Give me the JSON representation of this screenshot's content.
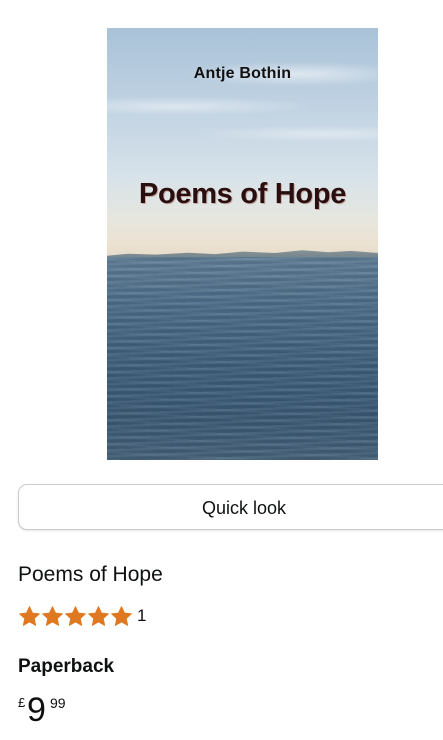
{
  "product": {
    "cover": {
      "author": "Antje Bothin",
      "title": "Poems of Hope"
    },
    "quick_look_label": "Quick look",
    "title": "Poems of Hope",
    "rating": {
      "stars": 5,
      "max_stars": 5,
      "count": "1",
      "star_color": "#de7921"
    },
    "format": "Paperback",
    "price": {
      "currency_symbol": "£",
      "whole": "9",
      "fraction": "99"
    }
  }
}
